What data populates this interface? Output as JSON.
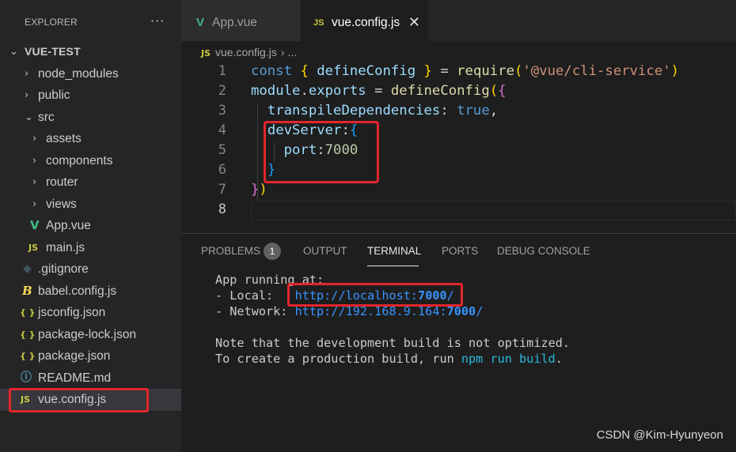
{
  "sidebar": {
    "title": "EXPLORER",
    "more": "···",
    "root": "VUE-TEST",
    "items": [
      {
        "label": "node_modules",
        "icon": "chevron-right"
      },
      {
        "label": "public",
        "icon": "chevron-right"
      },
      {
        "label": "src",
        "icon": "chevron-down"
      },
      {
        "label": "assets",
        "icon": "chevron-right"
      },
      {
        "label": "components",
        "icon": "chevron-right"
      },
      {
        "label": "router",
        "icon": "chevron-right"
      },
      {
        "label": "views",
        "icon": "chevron-right"
      },
      {
        "label": "App.vue",
        "icon": "vue-icon"
      },
      {
        "label": "main.js",
        "icon": "js-icon"
      },
      {
        "label": ".gitignore",
        "icon": "git-icon"
      },
      {
        "label": "babel.config.js",
        "icon": "babel-icon"
      },
      {
        "label": "jsconfig.json",
        "icon": "json-icon"
      },
      {
        "label": "package-lock.json",
        "icon": "json-icon"
      },
      {
        "label": "package.json",
        "icon": "json-icon"
      },
      {
        "label": "README.md",
        "icon": "info-icon"
      },
      {
        "label": "vue.config.js",
        "icon": "js-icon"
      }
    ],
    "icons": {
      "vue": "V",
      "js": "JS",
      "json": "{ }",
      "babel": "B",
      "git": "◆",
      "info": "ⓘ",
      "chevron_right": "›",
      "chevron_down": "⌄"
    }
  },
  "tabs": [
    {
      "label": "App.vue",
      "icon": "V",
      "active": false
    },
    {
      "label": "vue.config.js",
      "icon": "JS",
      "active": true,
      "close": "✕"
    }
  ],
  "breadcrumb": {
    "icon": "JS",
    "file": "vue.config.js",
    "sep": "›",
    "tail": "..."
  },
  "editor": {
    "line_numbers": [
      "1",
      "2",
      "3",
      "4",
      "5",
      "6",
      "7",
      "8"
    ],
    "lines": [
      "const { defineConfig } = require('@vue/cli-service')",
      "module.exports = defineConfig({",
      "  transpileDependencies: true,",
      "  devServer:{",
      "    port:7000",
      "  }",
      "})",
      ""
    ]
  },
  "panel": {
    "tabs": [
      "PROBLEMS",
      "OUTPUT",
      "TERMINAL",
      "PORTS",
      "DEBUG CONSOLE"
    ],
    "active_tab": "TERMINAL",
    "problems_count": "1",
    "terminal": {
      "line1": "App running at:",
      "local_label": "- Local:   ",
      "local_url_prefix": "http://localhost:",
      "local_port": "7000",
      "local_url_suffix": "/",
      "network_label": "- Network: ",
      "network_url_prefix": "http://192.168.9.164:",
      "network_port": "7000",
      "network_url_suffix": "/",
      "note1": "Note that the development build is not optimized.",
      "note2_prefix": "To create a production build, run ",
      "note2_cmd": "npm run build",
      "note2_suffix": "."
    }
  },
  "watermark": "CSDN @Kim-Hyunyeon",
  "colors": {
    "highlight_box": "#e3262c",
    "accent_blue": "#3794ff"
  }
}
